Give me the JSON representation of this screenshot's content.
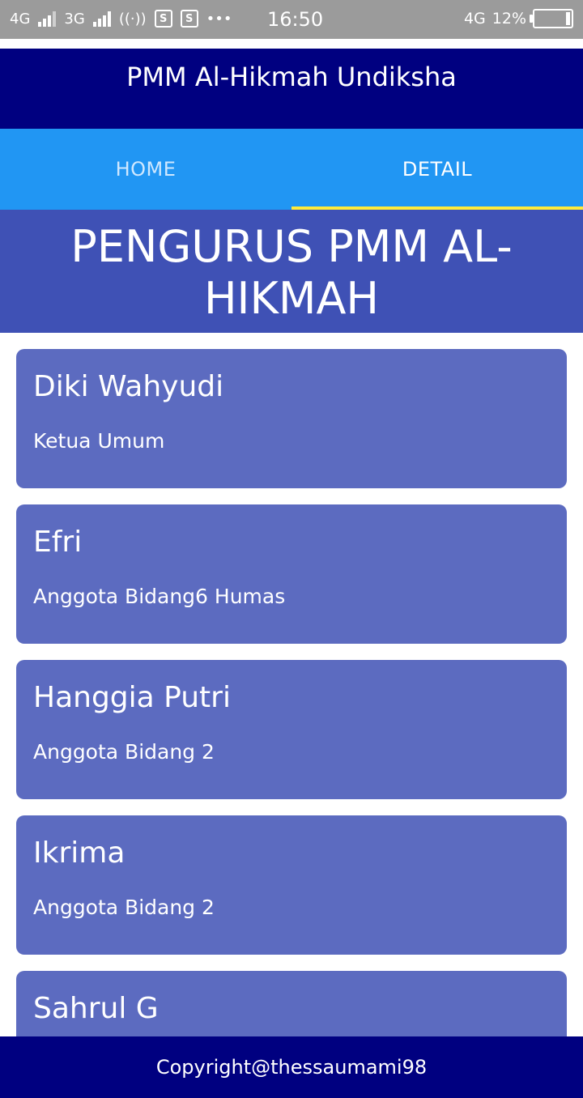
{
  "status_bar": {
    "net1": "4G",
    "net2": "3G",
    "hotspot_icon": "hotspot-icon",
    "app_icons": [
      "s-icon",
      "s-icon"
    ],
    "more": "•••",
    "time": "16:50",
    "net_right": "4G",
    "battery": "12%",
    "battery_level": 0.12
  },
  "app_bar": {
    "title": "PMM Al-Hikmah Undiksha"
  },
  "tabs": [
    {
      "label": "HOME",
      "active": false
    },
    {
      "label": "DETAIL",
      "active": true
    }
  ],
  "section": {
    "heading": "PENGURUS PMM AL-HIKMAH"
  },
  "members": [
    {
      "name": "Diki Wahyudi",
      "role": "Ketua Umum"
    },
    {
      "name": "Efri",
      "role": "Anggota Bidang6 Humas"
    },
    {
      "name": "Hanggia Putri",
      "role": "Anggota Bidang 2"
    },
    {
      "name": "Ikrima",
      "role": "Anggota Bidang 2"
    },
    {
      "name": "Sahrul G",
      "role": ""
    }
  ],
  "footer": {
    "text": "Copyright@thessaumami98"
  },
  "colors": {
    "app_bar": "#000080",
    "tab_bar": "#2196f3",
    "tab_indicator": "#ffeb3b",
    "section": "#3f51b5",
    "card": "#5c6bc0",
    "footer": "#000080"
  }
}
